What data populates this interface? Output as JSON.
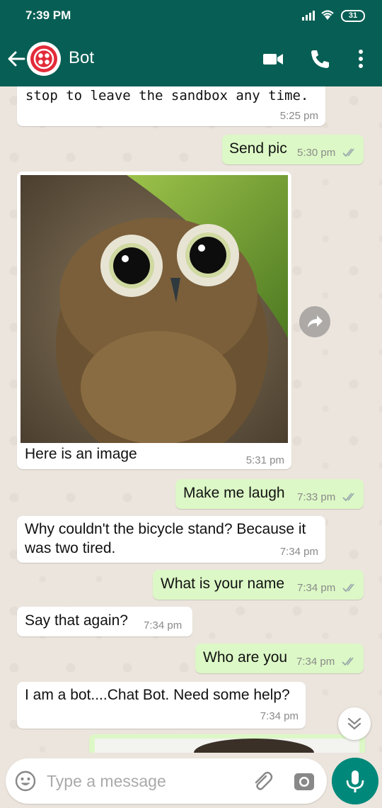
{
  "status_bar": {
    "time": "7:39 PM",
    "battery": "31"
  },
  "header": {
    "contact_name": "Bot"
  },
  "messages": [
    {
      "dir": "in",
      "text": "stop to leave the sandbox any time.",
      "time": "5:25 pm"
    },
    {
      "dir": "out",
      "text": "Send pic",
      "time": "5:30 pm"
    },
    {
      "dir": "in",
      "text": "Here is an image",
      "time": "5:31 pm",
      "image": "owl-photo"
    },
    {
      "dir": "out",
      "text": "Make me laugh",
      "time": "7:33 pm"
    },
    {
      "dir": "in",
      "text": "Why couldn't the bicycle stand? Because it was two tired.",
      "time": "7:34 pm"
    },
    {
      "dir": "out",
      "text": "What is your name",
      "time": "7:34 pm"
    },
    {
      "dir": "in",
      "text": "Say that again?",
      "time": "7:34 pm"
    },
    {
      "dir": "out",
      "text": "Who are you",
      "time": "7:34 pm"
    },
    {
      "dir": "in",
      "text": "I am a bot....Chat Bot. Need some help?",
      "time": "7:34 pm"
    }
  ],
  "composer": {
    "placeholder": "Type a message"
  },
  "colors": {
    "header": "#075e54",
    "outgoing_bubble": "#dcf8c6",
    "incoming_bubble": "#ffffff",
    "mic_button": "#00897b",
    "read_ticks": "#9aa7ad"
  },
  "icons": [
    "back-arrow-icon",
    "twilio-logo-icon",
    "video-call-icon",
    "phone-icon",
    "more-vert-icon",
    "forward-icon",
    "double-chevron-down-icon",
    "emoji-icon",
    "attach-icon",
    "camera-icon",
    "mic-icon"
  ]
}
